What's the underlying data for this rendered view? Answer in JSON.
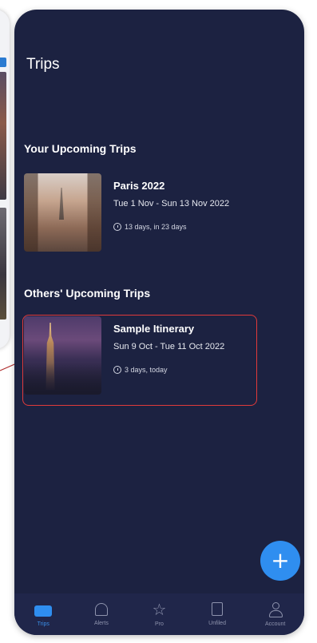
{
  "header": {
    "title": "Trips"
  },
  "sections": {
    "upcoming_title": "Your Upcoming Trips",
    "others_title": "Others' Upcoming Trips"
  },
  "trips": {
    "upcoming": [
      {
        "name": "Paris 2022",
        "dates": "Tue 1 Nov - Sun 13 Nov 2022",
        "duration": "13 days, in 23 days"
      }
    ],
    "others": [
      {
        "name": "Sample Itinerary",
        "dates": "Sun 9 Oct - Tue 11 Oct 2022",
        "duration": "3 days, today"
      }
    ]
  },
  "fab": {
    "label": "+"
  },
  "tabbar": {
    "tabs": [
      {
        "label": "Trips",
        "icon": "suitcase-icon",
        "active": true
      },
      {
        "label": "Alerts",
        "icon": "bell-icon",
        "active": false
      },
      {
        "label": "Pro",
        "icon": "star-icon",
        "active": false
      },
      {
        "label": "Unfiled",
        "icon": "document-icon",
        "active": false
      },
      {
        "label": "Account",
        "icon": "person-icon",
        "active": false
      }
    ]
  },
  "colors": {
    "background": "#1c2241",
    "accent": "#2f8ef0",
    "highlight": "#e03a3a"
  }
}
